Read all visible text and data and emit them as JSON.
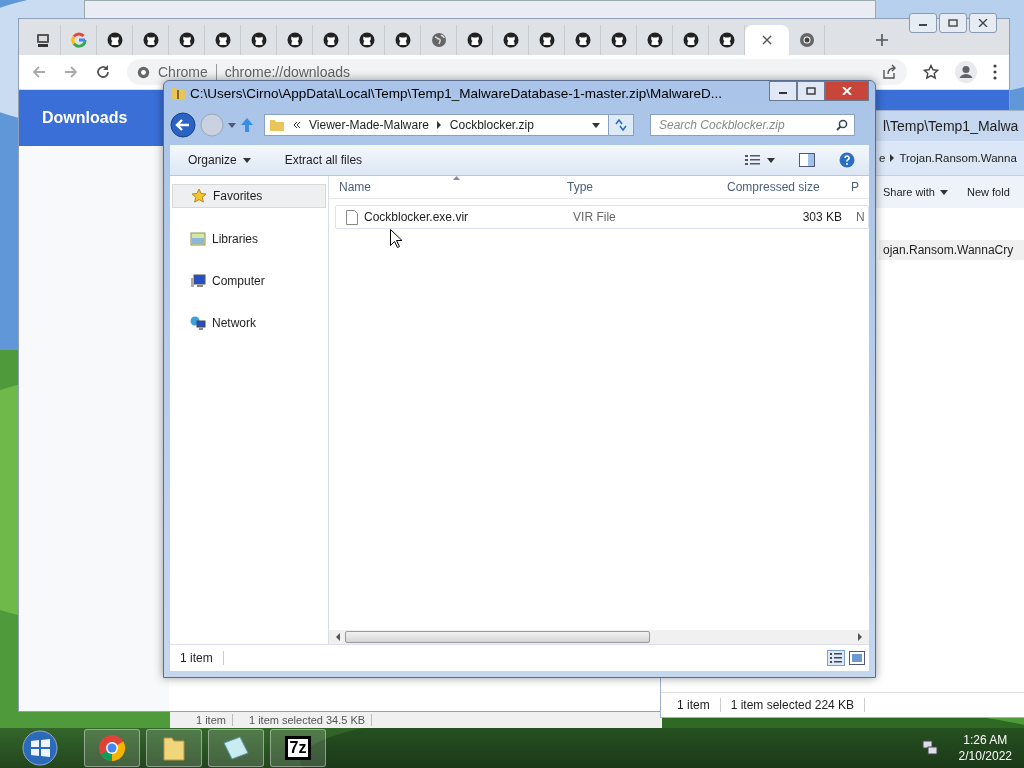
{
  "browser": {
    "tabs": [
      {
        "kind": "app",
        "selected": false
      },
      {
        "kind": "google",
        "selected": false
      },
      {
        "kind": "cat",
        "selected": false
      },
      {
        "kind": "cat",
        "selected": false
      },
      {
        "kind": "cat",
        "selected": false
      },
      {
        "kind": "cat",
        "selected": false
      },
      {
        "kind": "cat",
        "selected": false
      },
      {
        "kind": "cat",
        "selected": false
      },
      {
        "kind": "cat",
        "selected": false
      },
      {
        "kind": "cat",
        "selected": false
      },
      {
        "kind": "cat",
        "selected": false
      },
      {
        "kind": "globe",
        "selected": false
      },
      {
        "kind": "cat",
        "selected": false
      },
      {
        "kind": "cat",
        "selected": false
      },
      {
        "kind": "cat",
        "selected": false
      },
      {
        "kind": "cat",
        "selected": false
      },
      {
        "kind": "cat",
        "selected": false
      },
      {
        "kind": "cat",
        "selected": false
      },
      {
        "kind": "cat",
        "selected": false
      },
      {
        "kind": "cat",
        "selected": false
      },
      {
        "kind": "blank",
        "selected": true
      },
      {
        "kind": "chrome",
        "selected": false
      }
    ],
    "chip": "Chrome",
    "url": "chrome://downloads",
    "page_title": "Downloads"
  },
  "back_explorer": {
    "title": "l\\Temp\\Temp1_Malwa",
    "crumbs": [
      "e",
      "Trojan.Ransom.Wanna"
    ],
    "commands": [
      "Share with",
      "New fold"
    ],
    "row": "ojan.Ransom.WannaCry",
    "status": [
      "1 item",
      "1 item selected  224 KB"
    ]
  },
  "lower_window": {
    "status": [
      "1 item",
      "1 item selected  34.5 KB"
    ]
  },
  "explorer": {
    "title": "C:\\Users\\Cirno\\AppData\\Local\\Temp\\Temp1_MalwareDatabase-1-master.zip\\MalwareD...",
    "crumbs": [
      "Viewer-Made-Malware",
      "Cockblocker.zip"
    ],
    "search": {
      "placeholder": "Search Cockblocker.zip"
    },
    "commands": [
      "Organize",
      "Extract all files"
    ],
    "nav": [
      {
        "label": "Favorites",
        "kind": "star",
        "selected": true
      },
      {
        "label": "Libraries",
        "kind": "library",
        "selected": false
      },
      {
        "label": "Computer",
        "kind": "computer",
        "selected": false
      },
      {
        "label": "Network",
        "kind": "network",
        "selected": false
      }
    ],
    "columns": [
      "Name",
      "Type",
      "Compressed size",
      "P"
    ],
    "rows": [
      {
        "cells": [
          "Cockblocker.exe.vir",
          "VIR File",
          "303 KB",
          "N"
        ]
      }
    ],
    "status": "1 item"
  },
  "taskbar": {
    "apps": [
      {
        "kind": "chrome"
      },
      {
        "kind": "folder"
      },
      {
        "kind": "notepad"
      },
      {
        "kind": "sevenzip",
        "label": "7z"
      }
    ],
    "time": "1:26 AM",
    "date": "2/10/2022"
  }
}
